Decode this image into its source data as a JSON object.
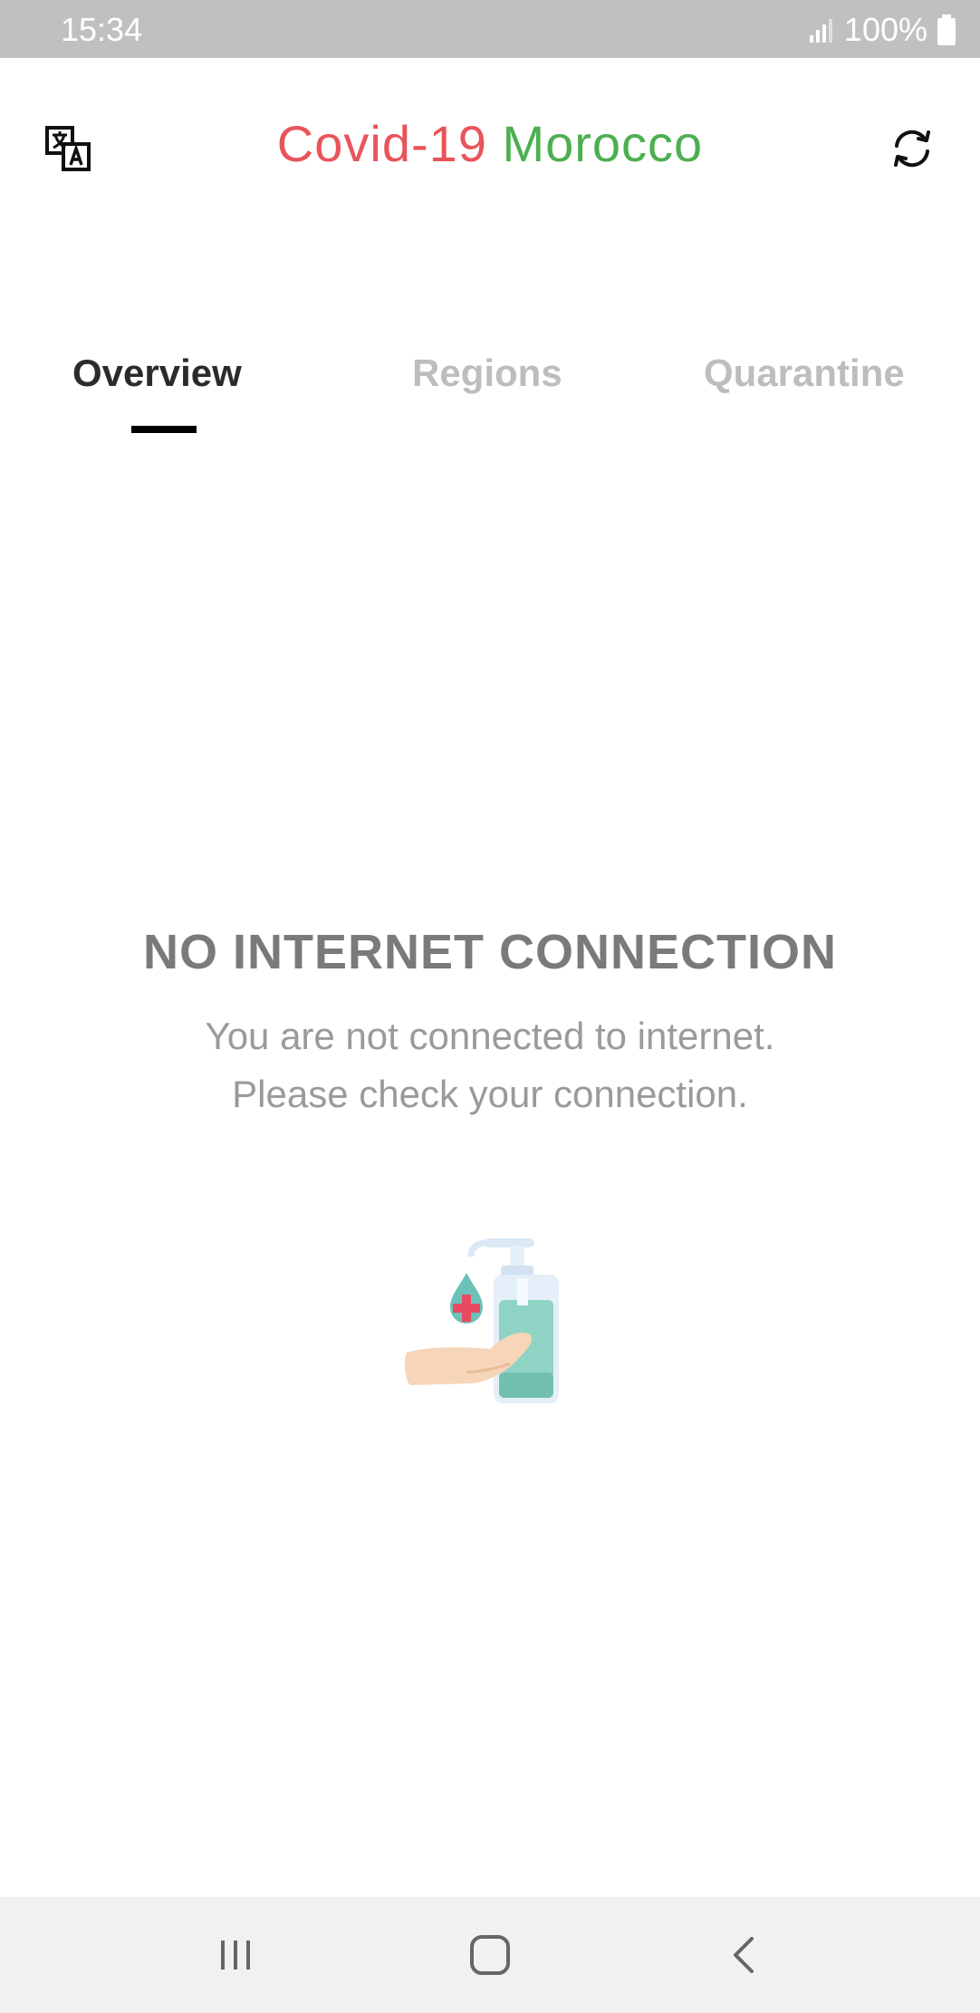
{
  "status_bar": {
    "time": "15:34",
    "battery": "100%",
    "signal_icon": "signal-icon",
    "battery_icon": "battery-icon"
  },
  "header": {
    "title_part1": "Covid-19",
    "title_part2": "Morocco",
    "title_color_1": "#e9545a",
    "title_color_2": "#4caf50",
    "left_icon": "translate-icon",
    "right_icon": "refresh-icon"
  },
  "tabs": [
    {
      "label": "Overview",
      "active": true
    },
    {
      "label": "Regions",
      "active": false
    },
    {
      "label": "Quarantine",
      "active": false
    }
  ],
  "empty_state": {
    "title": "NO INTERNET CONNECTION",
    "line1": "You are not connected to internet.",
    "line2": "Please check your connection.",
    "illustration": "hand-sanitizer-illustration"
  },
  "nav_bar": {
    "recent_icon": "recent-apps-icon",
    "home_icon": "home-icon",
    "back_icon": "back-icon"
  }
}
